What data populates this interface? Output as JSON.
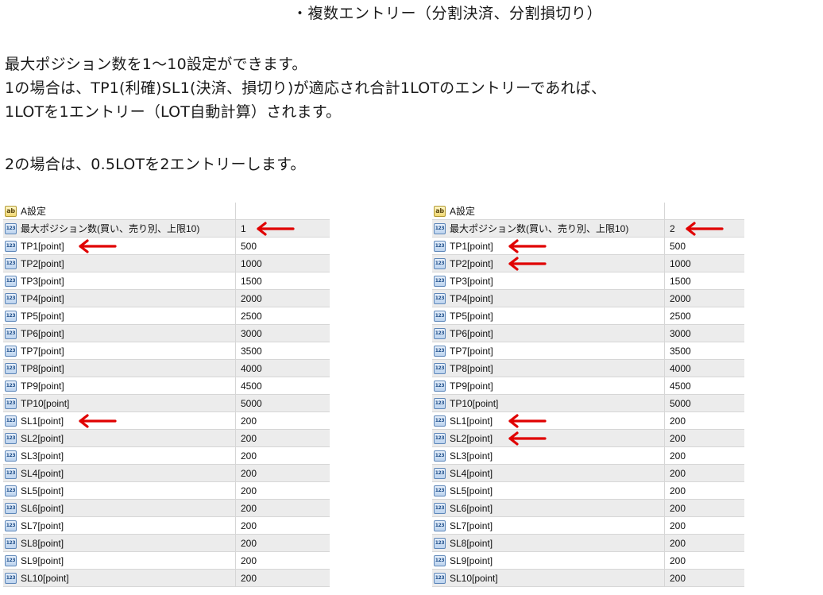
{
  "heading": "・複数エントリー（分割決済、分割損切り）",
  "paragraphs": [
    "最大ポジション数を1〜10設定ができます。",
    "1の場合は、TP1(利確)SL1(決済、損切り)が適応され合計1LOTのエントリーであれば、",
    "1LOTを1エントリー（LOT自動計算）されます。",
    "2の場合は、0.5LOTを2エントリーします。"
  ],
  "icons": {
    "header": "ab",
    "row": "123"
  },
  "accent_color": "#e00000",
  "left_panel": {
    "header": "A設定",
    "rows": [
      {
        "name": "最大ポジション数(買い、売り別、上限10)",
        "value": "1"
      },
      {
        "name": "TP1[point]",
        "value": "500"
      },
      {
        "name": "TP2[point]",
        "value": "1000"
      },
      {
        "name": "TP3[point]",
        "value": "1500"
      },
      {
        "name": "TP4[point]",
        "value": "2000"
      },
      {
        "name": "TP5[point]",
        "value": "2500"
      },
      {
        "name": "TP6[point]",
        "value": "3000"
      },
      {
        "name": "TP7[point]",
        "value": "3500"
      },
      {
        "name": "TP8[point]",
        "value": "4000"
      },
      {
        "name": "TP9[point]",
        "value": "4500"
      },
      {
        "name": "TP10[point]",
        "value": "5000"
      },
      {
        "name": "SL1[point]",
        "value": "200"
      },
      {
        "name": "SL2[point]",
        "value": "200"
      },
      {
        "name": "SL3[point]",
        "value": "200"
      },
      {
        "name": "SL4[point]",
        "value": "200"
      },
      {
        "name": "SL5[point]",
        "value": "200"
      },
      {
        "name": "SL6[point]",
        "value": "200"
      },
      {
        "name": "SL7[point]",
        "value": "200"
      },
      {
        "name": "SL8[point]",
        "value": "200"
      },
      {
        "name": "SL9[point]",
        "value": "200"
      },
      {
        "name": "SL10[point]",
        "value": "200"
      }
    ]
  },
  "right_panel": {
    "header": "A設定",
    "rows": [
      {
        "name": "最大ポジション数(買い、売り別、上限10)",
        "value": "2"
      },
      {
        "name": "TP1[point]",
        "value": "500"
      },
      {
        "name": "TP2[point]",
        "value": "1000"
      },
      {
        "name": "TP3[point]",
        "value": "1500"
      },
      {
        "name": "TP4[point]",
        "value": "2000"
      },
      {
        "name": "TP5[point]",
        "value": "2500"
      },
      {
        "name": "TP6[point]",
        "value": "3000"
      },
      {
        "name": "TP7[point]",
        "value": "3500"
      },
      {
        "name": "TP8[point]",
        "value": "4000"
      },
      {
        "name": "TP9[point]",
        "value": "4500"
      },
      {
        "name": "TP10[point]",
        "value": "5000"
      },
      {
        "name": "SL1[point]",
        "value": "200"
      },
      {
        "name": "SL2[point]",
        "value": "200"
      },
      {
        "name": "SL3[point]",
        "value": "200"
      },
      {
        "name": "SL4[point]",
        "value": "200"
      },
      {
        "name": "SL5[point]",
        "value": "200"
      },
      {
        "name": "SL6[point]",
        "value": "200"
      },
      {
        "name": "SL7[point]",
        "value": "200"
      },
      {
        "name": "SL8[point]",
        "value": "200"
      },
      {
        "name": "SL9[point]",
        "value": "200"
      },
      {
        "name": "SL10[point]",
        "value": "200"
      }
    ]
  }
}
